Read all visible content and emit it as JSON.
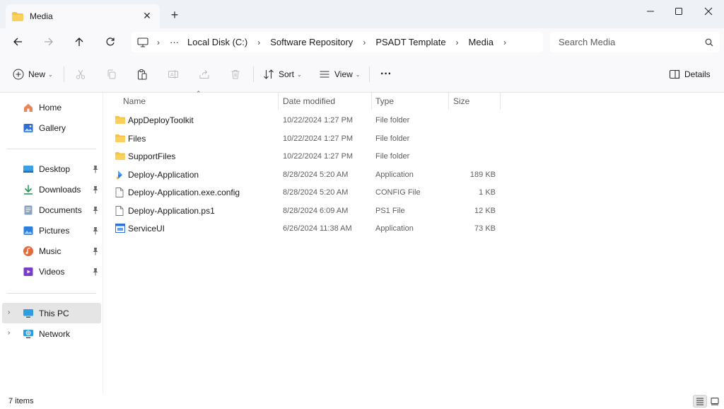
{
  "window": {
    "tab_title": "Media",
    "tab_close": "✕",
    "new_tab": "+"
  },
  "address": {
    "overflow": "···",
    "segments": [
      "Local Disk (C:)",
      "Software Repository",
      "PSADT Template",
      "Media"
    ]
  },
  "search": {
    "placeholder": "Search Media"
  },
  "commands": {
    "new": "New",
    "sort": "Sort",
    "view": "View",
    "more": "···",
    "details": "Details"
  },
  "sidebar": {
    "quick": [
      {
        "label": "Home"
      },
      {
        "label": "Gallery"
      }
    ],
    "pinned": [
      {
        "label": "Desktop"
      },
      {
        "label": "Downloads"
      },
      {
        "label": "Documents"
      },
      {
        "label": "Pictures"
      },
      {
        "label": "Music"
      },
      {
        "label": "Videos"
      }
    ],
    "tree": [
      {
        "label": "This PC"
      },
      {
        "label": "Network"
      }
    ]
  },
  "columns": {
    "name": "Name",
    "date": "Date modified",
    "type": "Type",
    "size": "Size"
  },
  "files": [
    {
      "name": "AppDeployToolkit",
      "date": "10/22/2024 1:27 PM",
      "type": "File folder",
      "size": "",
      "icon": "folder-icon"
    },
    {
      "name": "Files",
      "date": "10/22/2024 1:27 PM",
      "type": "File folder",
      "size": "",
      "icon": "folder-icon"
    },
    {
      "name": "SupportFiles",
      "date": "10/22/2024 1:27 PM",
      "type": "File folder",
      "size": "",
      "icon": "folder-icon"
    },
    {
      "name": "Deploy-Application",
      "date": "8/28/2024 5:20 AM",
      "type": "Application",
      "size": "189 KB",
      "icon": "app-icon"
    },
    {
      "name": "Deploy-Application.exe.config",
      "date": "8/28/2024 5:20 AM",
      "type": "CONFIG File",
      "size": "1 KB",
      "icon": "file-icon"
    },
    {
      "name": "Deploy-Application.ps1",
      "date": "8/28/2024 6:09 AM",
      "type": "PS1 File",
      "size": "12 KB",
      "icon": "file-icon"
    },
    {
      "name": "ServiceUI",
      "date": "6/26/2024 11:38 AM",
      "type": "Application",
      "size": "73 KB",
      "icon": "window-app-icon"
    }
  ],
  "status": {
    "count": "7 items"
  },
  "colors": {
    "folder": "#f6c445",
    "accent": "#0067c0",
    "chrome": "#eef1f6"
  }
}
